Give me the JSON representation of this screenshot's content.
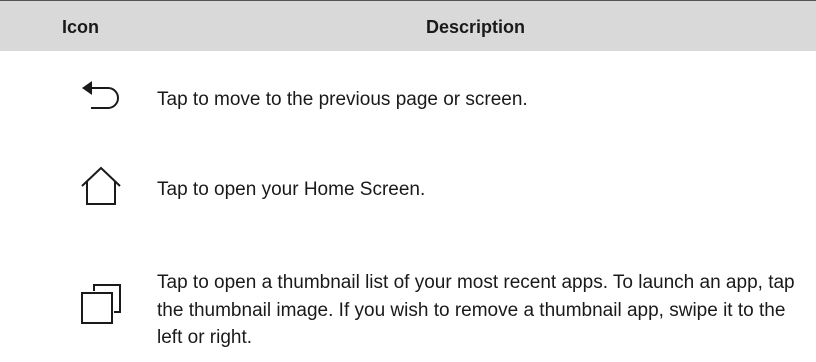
{
  "table": {
    "headers": {
      "icon": "Icon",
      "description": "Description"
    },
    "rows": [
      {
        "icon": "back-icon",
        "description": "Tap to move to the previous page or screen."
      },
      {
        "icon": "home-icon",
        "description": "Tap to open your Home Screen."
      },
      {
        "icon": "recent-apps-icon",
        "description": "Tap to open a thumbnail list of your most recent apps. To launch an app, tap the thumbnail image. If you wish to remove a thumbnail app, swipe it to the left or right."
      }
    ]
  }
}
